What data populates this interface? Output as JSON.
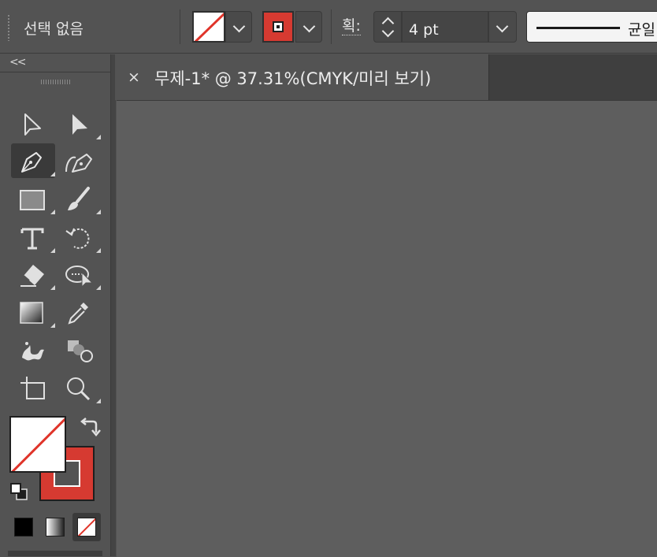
{
  "control_bar": {
    "selection_status": "선택 없음",
    "fill_swatch": "none",
    "stroke_swatch_color": "#d63a31",
    "stroke_weight_label": "획:",
    "stroke_weight_value": "4 pt",
    "stroke_profile_label": "균일"
  },
  "document": {
    "tab_title": "무제-1* @ 37.31%(CMYK/미리 보기)",
    "close_glyph": "×"
  },
  "toolbar": {
    "collapse_glyph": "<<",
    "tools": [
      {
        "name": "selection-tool",
        "icon": "arrow-outline-icon"
      },
      {
        "name": "direct-selection-tool",
        "icon": "arrow-solid-icon"
      },
      {
        "name": "pen-tool",
        "icon": "pen-icon",
        "active": true
      },
      {
        "name": "curvature-tool",
        "icon": "curvature-pen-icon"
      },
      {
        "name": "rectangle-tool",
        "icon": "rectangle-icon"
      },
      {
        "name": "paintbrush-tool",
        "icon": "brush-icon"
      },
      {
        "name": "type-tool",
        "icon": "type-icon"
      },
      {
        "name": "rotate-tool",
        "icon": "rotate-icon"
      },
      {
        "name": "eraser-tool",
        "icon": "eraser-icon"
      },
      {
        "name": "puppet-warp-tool",
        "icon": "puppet-warp-icon"
      },
      {
        "name": "gradient-tool",
        "icon": "gradient-icon"
      },
      {
        "name": "eyedropper-tool",
        "icon": "eyedropper-icon"
      },
      {
        "name": "symbol-sprayer-tool",
        "icon": "symbol-sprayer-icon"
      },
      {
        "name": "shape-builder-tool",
        "icon": "shape-builder-icon"
      },
      {
        "name": "artboard-tool",
        "icon": "artboard-icon"
      },
      {
        "name": "zoom-tool",
        "icon": "zoom-icon"
      }
    ],
    "fill_color": "none",
    "stroke_color": "#d63a31",
    "modes": [
      "color",
      "gradient",
      "none"
    ],
    "active_mode": "none"
  },
  "colors": {
    "ui_background": "#535353",
    "canvas": "#5e5e5e",
    "accent_red": "#d63a31"
  }
}
